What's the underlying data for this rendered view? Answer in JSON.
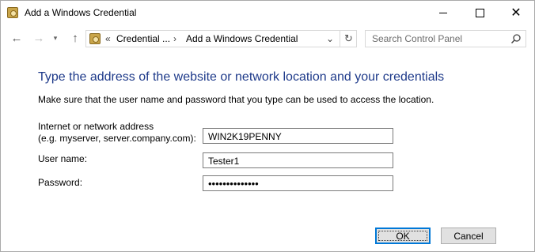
{
  "window": {
    "title": "Add a Windows Credential",
    "icon": "credential-manager-icon",
    "controls": {
      "minimize": "minimize-icon",
      "maximize": "maximize-icon",
      "close": "✕"
    }
  },
  "nav": {
    "back_icon": "←",
    "forward_icon": "→",
    "recent_icon": "▾",
    "up_icon": "↑",
    "address": {
      "overflow": "«",
      "breadcrumb": [
        "Credential ...",
        "Add a Windows Credential"
      ],
      "separator": "›",
      "refresh_icon": "↻"
    },
    "search": {
      "placeholder": "Search Control Panel"
    }
  },
  "content": {
    "heading": "Type the address of the website or network location and your credentials",
    "instruction": "Make sure that the user name and password that you type can be used to access the location.",
    "fields": {
      "address_label_line1": "Internet or network address",
      "address_label_line2": "(e.g. myserver, server.company.com):",
      "address_value": "WIN2K19PENNY",
      "user_label": "User name:",
      "user_value": "Tester1",
      "password_label": "Password:",
      "password_value": "••••••••••••••"
    }
  },
  "buttons": {
    "ok": "OK",
    "cancel": "Cancel"
  },
  "colors": {
    "heading": "#1e3a8a",
    "focus": "#0078d7"
  }
}
